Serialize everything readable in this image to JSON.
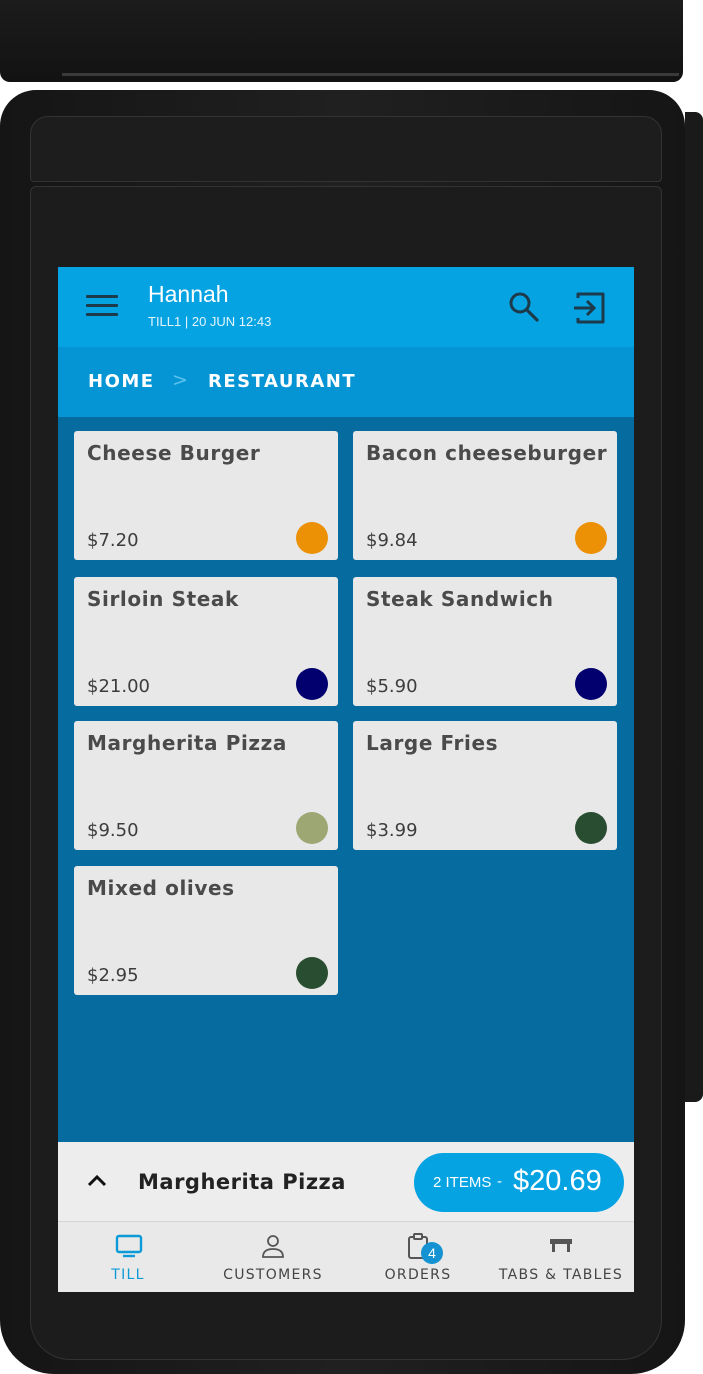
{
  "header": {
    "user_name": "Hannah",
    "till_info": "TILL1 | 20 JUN 12:43"
  },
  "breadcrumb": {
    "items": [
      "HOME",
      "RESTAURANT"
    ],
    "separator": ">"
  },
  "products": [
    {
      "name": "Cheese Burger",
      "price": "$7.20",
      "color": "#ec9006"
    },
    {
      "name": "Bacon cheeseburger",
      "price": "$9.84",
      "color": "#ec9006"
    },
    {
      "name": "Sirloin Steak",
      "price": "$21.00",
      "color": "#02006f"
    },
    {
      "name": "Steak Sandwich",
      "price": "$5.90",
      "color": "#02006f"
    },
    {
      "name": "Margherita Pizza",
      "price": "$9.50",
      "color": "#9da773"
    },
    {
      "name": "Large Fries",
      "price": "$3.99",
      "color": "#294d30"
    },
    {
      "name": "Mixed olives",
      "price": "$2.95",
      "color": "#294d30"
    }
  ],
  "order": {
    "current_item": "Margherita Pizza",
    "items_count": "2 ITEMS",
    "separator": "-",
    "total": "$20.69"
  },
  "nav": {
    "items": [
      {
        "label": "TILL",
        "icon": "monitor-icon",
        "active": true
      },
      {
        "label": "CUSTOMERS",
        "icon": "person-icon",
        "active": false
      },
      {
        "label": "ORDERS",
        "icon": "clipboard-icon",
        "active": false,
        "badge": "4"
      },
      {
        "label": "TABS & TABLES",
        "icon": "table-icon",
        "active": false
      }
    ]
  },
  "colors": {
    "app_bar": "#06a3e3",
    "breadcrumb_bar": "#0594d4",
    "content_bg": "#066b9f",
    "accent": "#06a3e3"
  }
}
